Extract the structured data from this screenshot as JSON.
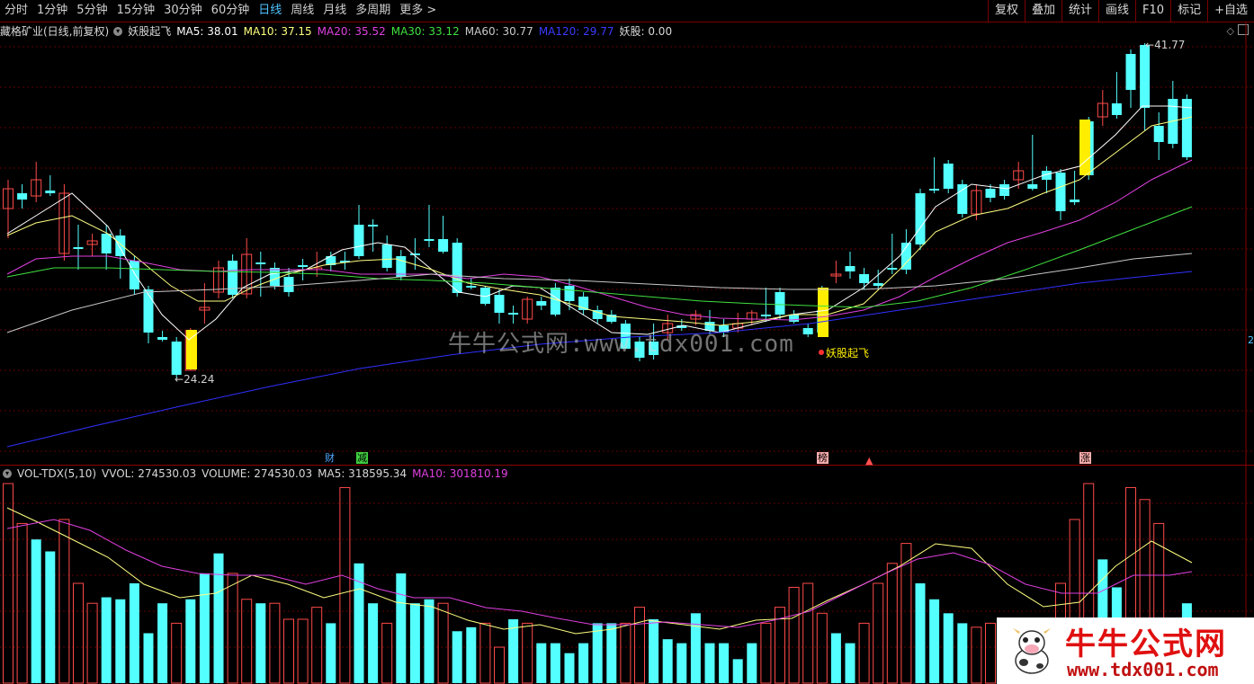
{
  "toolbar": {
    "timeframes": [
      "分时",
      "1分钟",
      "5分钟",
      "15分钟",
      "30分钟",
      "60分钟",
      "日线",
      "周线",
      "月线",
      "多周期",
      "更多 >"
    ],
    "active_index": 6,
    "tools": [
      "复权",
      "叠加",
      "统计",
      "画线",
      "F10",
      "标记",
      "+自选"
    ]
  },
  "colors": {
    "up": "#ff4a4a",
    "down": "#54ffff",
    "signal": "#ffee00",
    "ma5": "#ffffff",
    "ma10": "#ffff80",
    "ma20": "#e040e0",
    "ma30": "#40e040",
    "ma60": "#c8c8c8",
    "ma120": "#3030ff",
    "grid": "#600000"
  },
  "main_info": {
    "stock": "藏格矿业(日线,前复权)",
    "indicator": "妖股起飞",
    "ma5": "MA5: 38.01",
    "ma10": "MA10: 37.15",
    "ma20": "MA20: 35.52",
    "ma30": "MA30: 33.12",
    "ma60": "MA60: 30.77",
    "ma120": "MA120: 29.77",
    "yaogu": "妖股: 0.00"
  },
  "vol_info": {
    "name": "VOL-TDX(5,10)",
    "vvol": "VVOL: 274530.03",
    "volume": "VOLUME: 274530.03",
    "ma5": "MA5: 318595.34",
    "ma10": "MA10: 301810.19"
  },
  "annotations": {
    "high": "41.77",
    "low": "24.24",
    "signal_label": "妖股起飞",
    "tag_cai": "财",
    "tag_jian": "减",
    "tag_bang": "榜",
    "tag_zhang": "涨",
    "right_edge": "2"
  },
  "watermark": "牛牛公式网:www.tdx001.com",
  "logo": {
    "title": "牛牛公式网",
    "url": "www.tdx001.com"
  }
}
